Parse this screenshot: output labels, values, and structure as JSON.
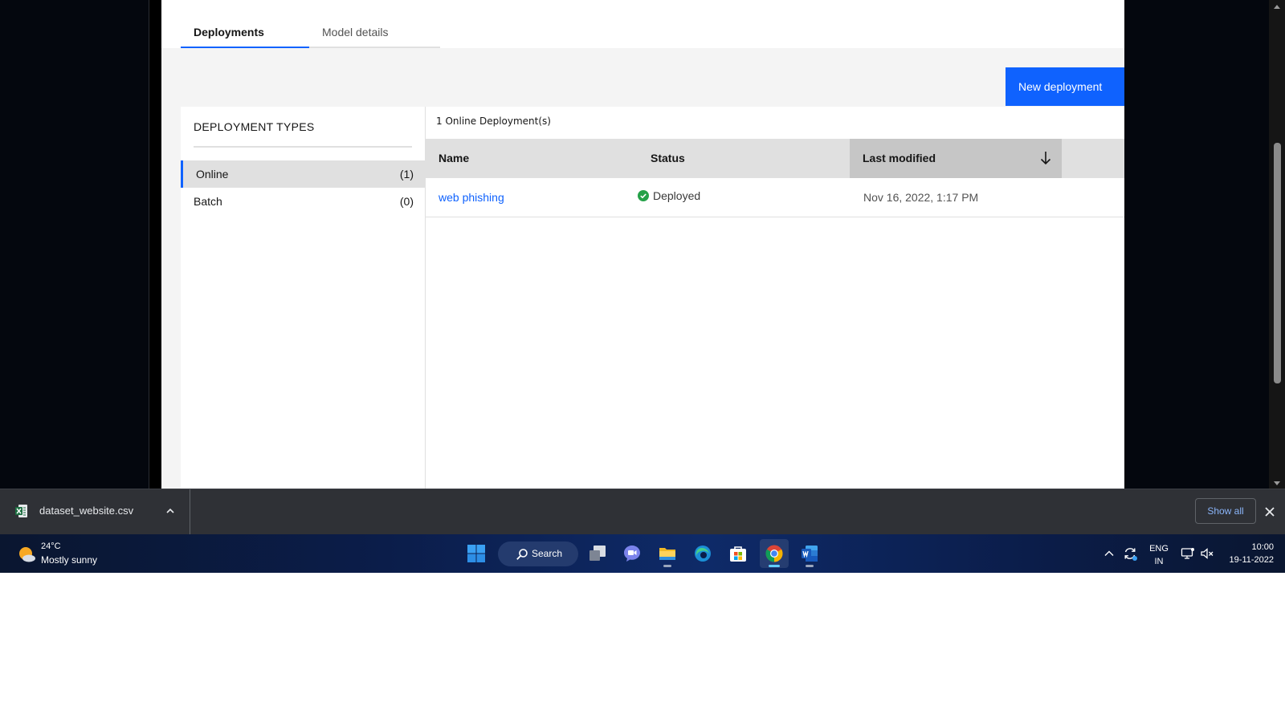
{
  "tabs": [
    {
      "label": "Deployments",
      "active": true
    },
    {
      "label": "Model details",
      "active": false
    }
  ],
  "new_deployment_label": "New deployment",
  "deployment_types": {
    "title": "DEPLOYMENT TYPES",
    "items": [
      {
        "label": "Online",
        "count": "(1)",
        "active": true
      },
      {
        "label": "Batch",
        "count": "(0)",
        "active": false
      }
    ]
  },
  "deployments_table": {
    "count_text": "1 Online Deployment(s)",
    "columns": {
      "name": "Name",
      "status": "Status",
      "last_modified": "Last modified"
    },
    "sort": {
      "column": "Last modified",
      "direction": "descending"
    },
    "rows": [
      {
        "name": "web phishing",
        "status": "Deployed",
        "last_modified": "Nov 16, 2022, 1:17 PM"
      }
    ]
  },
  "download_bar": {
    "file_name": "dataset_website.csv",
    "show_all_label": "Show all"
  },
  "taskbar": {
    "weather": {
      "temp": "24°C",
      "condition": "Mostly sunny"
    },
    "search_label": "Search",
    "apps": [
      "windows-start",
      "search",
      "task-view",
      "teams-chat",
      "file-explorer",
      "edge",
      "microsoft-store",
      "chrome",
      "word"
    ],
    "language": {
      "line1": "ENG",
      "line2": "IN"
    },
    "clock": {
      "time": "10:00",
      "date": "19-11-2022"
    }
  },
  "colors": {
    "accent": "#0f62fe",
    "status_success": "#24a148",
    "page_bg": "#f4f4f4",
    "download_bar": "#2f3136",
    "taskbar": "#0b1d4a"
  }
}
